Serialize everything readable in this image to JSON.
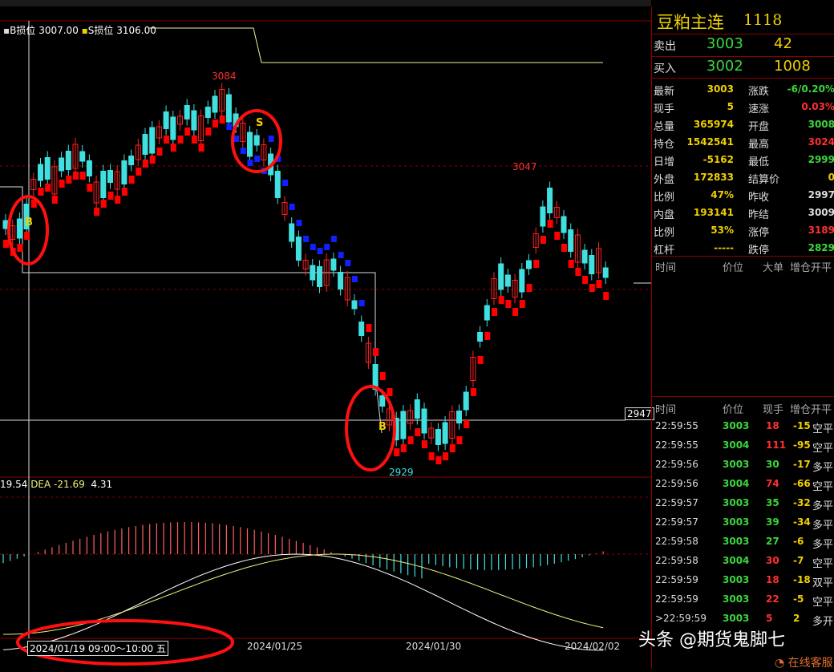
{
  "chart": {
    "legend_b_label": "B损位",
    "legend_b_value": "3007.00",
    "legend_s_label": "S损位",
    "legend_s_value": "3106.00",
    "high_label": "3084",
    "peak2_label": "3047",
    "low_label": "2929",
    "price_marker": "2947",
    "signal_b1": "B",
    "signal_s": "S",
    "signal_b2": "B",
    "macd_dif": "19.54",
    "macd_dea_label": "DEA",
    "macd_dea": "-21.69",
    "macd_val": "4.31",
    "date_cursor": "2024/01/19 09:00～10:00 五",
    "date_ticks": [
      "2024/01/25",
      "2024/01/30",
      "2024/02/02"
    ],
    "colors": {
      "up": "#ff2020",
      "down": "#40e0e0",
      "bull_ma": "#ff0000",
      "bear_ma": "#1020ff",
      "grid": "#8b0000",
      "highlight": "#ff0000"
    }
  },
  "panel": {
    "title": "豆粕主连",
    "code": "1118",
    "ask": {
      "label": "卖出",
      "price": "3003",
      "vol": "42"
    },
    "bid": {
      "label": "买入",
      "price": "3002",
      "vol": "1008"
    },
    "quotes": [
      {
        "k1": "最新",
        "v1": "3003",
        "c1": "#f0d000",
        "k2": "涨跌",
        "v2": "-6/0.20%",
        "c2": "#3cd63c"
      },
      {
        "k1": "现手",
        "v1": "5",
        "c1": "#f0d000",
        "k2": "速涨",
        "v2": "0.03%",
        "c2": "#ff3030"
      },
      {
        "k1": "总量",
        "v1": "365974",
        "c1": "#f0d000",
        "k2": "开盘",
        "v2": "3008",
        "c2": "#3cd63c"
      },
      {
        "k1": "持仓",
        "v1": "1542541",
        "c1": "#f0d000",
        "k2": "最高",
        "v2": "3024",
        "c2": "#ff3030"
      },
      {
        "k1": "日增",
        "v1": "-5162",
        "c1": "#f0d000",
        "k2": "最低",
        "v2": "2999",
        "c2": "#3cd63c"
      },
      {
        "k1": "外盘",
        "v1": "172833",
        "c1": "#f0d000",
        "k2": "结算价",
        "v2": "0",
        "c2": "#f0d000"
      },
      {
        "k1": "比例",
        "v1": "47%",
        "c1": "#f0d000",
        "k2": "昨收",
        "v2": "2997",
        "c2": "#ddd"
      },
      {
        "k1": "内盘",
        "v1": "193141",
        "c1": "#f0d000",
        "k2": "昨结",
        "v2": "3009",
        "c2": "#ddd"
      },
      {
        "k1": "比例",
        "v1": "53%",
        "c1": "#f0d000",
        "k2": "涨停",
        "v2": "3189",
        "c2": "#ff3030"
      },
      {
        "k1": "杠杆",
        "v1": "-----",
        "c1": "#f0d000",
        "k2": "跌停",
        "v2": "2829",
        "c2": "#3cd63c"
      }
    ],
    "big_order_headers": [
      "时间",
      "价位",
      "大单",
      "增仓",
      "开平"
    ],
    "tick_headers": [
      "时间",
      "价位",
      "现手",
      "增仓",
      "开平"
    ],
    "ticks": [
      {
        "time": "22:59:55",
        "price": "3003",
        "vol": "18",
        "chg": "-15",
        "type": "空平",
        "pc": "#3cd63c",
        "vc": "#ff3030",
        "cc": "#f0d000"
      },
      {
        "time": "22:59:55",
        "price": "3004",
        "vol": "111",
        "chg": "-95",
        "type": "空平",
        "pc": "#3cd63c",
        "vc": "#ff3030",
        "cc": "#f0d000"
      },
      {
        "time": "22:59:56",
        "price": "3003",
        "vol": "30",
        "chg": "-17",
        "type": "多平",
        "pc": "#3cd63c",
        "vc": "#3cd63c",
        "cc": "#f0d000"
      },
      {
        "time": "22:59:56",
        "price": "3004",
        "vol": "74",
        "chg": "-66",
        "type": "空平",
        "pc": "#3cd63c",
        "vc": "#ff3030",
        "cc": "#f0d000"
      },
      {
        "time": "22:59:57",
        "price": "3003",
        "vol": "35",
        "chg": "-32",
        "type": "多平",
        "pc": "#3cd63c",
        "vc": "#3cd63c",
        "cc": "#f0d000"
      },
      {
        "time": "22:59:57",
        "price": "3003",
        "vol": "39",
        "chg": "-34",
        "type": "多平",
        "pc": "#3cd63c",
        "vc": "#3cd63c",
        "cc": "#f0d000"
      },
      {
        "time": "22:59:58",
        "price": "3003",
        "vol": "27",
        "chg": "-6",
        "type": "多平",
        "pc": "#3cd63c",
        "vc": "#3cd63c",
        "cc": "#f0d000"
      },
      {
        "time": "22:59:58",
        "price": "3004",
        "vol": "30",
        "chg": "-7",
        "type": "空平",
        "pc": "#3cd63c",
        "vc": "#ff3030",
        "cc": "#f0d000"
      },
      {
        "time": "22:59:59",
        "price": "3003",
        "vol": "18",
        "chg": "-18",
        "type": "双平",
        "pc": "#3cd63c",
        "vc": "#ff3030",
        "cc": "#f0d000"
      },
      {
        "time": "22:59:59",
        "price": "3003",
        "vol": "22",
        "chg": "-5",
        "type": "空平",
        "pc": "#3cd63c",
        "vc": "#ff3030",
        "cc": "#f0d000"
      },
      {
        "time": ">22:59:59",
        "price": "3003",
        "vol": "5",
        "chg": "2",
        "type": "多开",
        "pc": "#3cd63c",
        "vc": "#ff3030",
        "cc": "#f0d000"
      }
    ]
  },
  "watermark": "头条 @期货鬼脚七",
  "service_link": "在线客服"
}
